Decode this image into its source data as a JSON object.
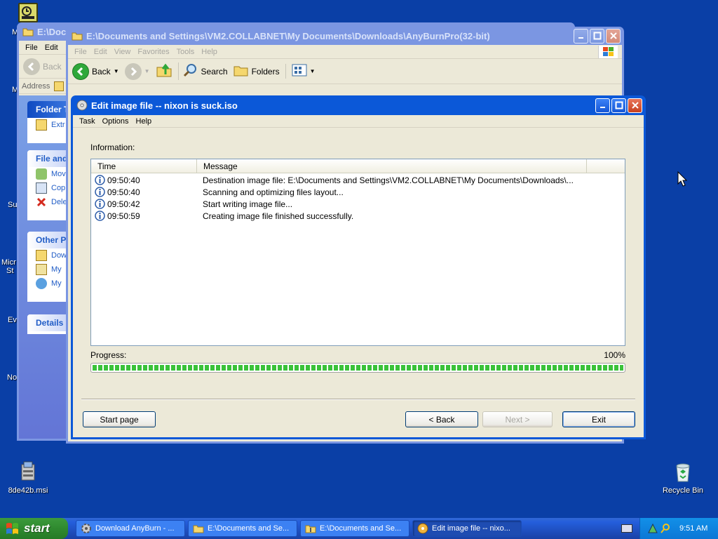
{
  "desktop": {
    "icons": [
      {
        "label": "8de42b.msi"
      },
      {
        "label": "Recycle Bin"
      }
    ],
    "edge_labels": [
      "M",
      "M",
      "Su",
      "Micr",
      "St",
      "Ev",
      "No"
    ]
  },
  "explorer_back": {
    "title": "E:\\Docu",
    "menu": [
      "File",
      "Edit"
    ],
    "back_label": "Back",
    "address_label": "Address",
    "panes": [
      {
        "header": "Folder T",
        "items": [
          "Extr"
        ]
      },
      {
        "header": "File and",
        "items": [
          "Mov",
          "Cop",
          "Dele"
        ]
      },
      {
        "header": "Other P",
        "items": [
          "Dow",
          "My",
          "My"
        ]
      },
      {
        "header": "Details",
        "items": []
      }
    ]
  },
  "explorer_front": {
    "title": "E:\\Documents and Settings\\VM2.COLLABNET\\My Documents\\Downloads\\AnyBurnPro(32-bit)",
    "menu": [
      "File",
      "Edit",
      "View",
      "Favorites",
      "Tools",
      "Help"
    ],
    "toolbar": {
      "back": "Back",
      "search": "Search",
      "folders": "Folders"
    }
  },
  "dialog": {
    "title": "Edit image file -- nixon is suck.iso",
    "menu": [
      "Task",
      "Options",
      "Help"
    ],
    "info_label": "Information:",
    "columns": [
      "Time",
      "Message"
    ],
    "rows": [
      {
        "time": "09:50:40",
        "message": "Destination image file:  E:\\Documents and Settings\\VM2.COLLABNET\\My Documents\\Downloads\\..."
      },
      {
        "time": "09:50:40",
        "message": "Scanning and optimizing files layout..."
      },
      {
        "time": "09:50:42",
        "message": "Start writing image file..."
      },
      {
        "time": "09:50:59",
        "message": "Creating image file finished successfully."
      }
    ],
    "progress_label": "Progress:",
    "progress_text": "100%",
    "progress_value": 1.0,
    "buttons": {
      "start_page": "Start page",
      "back": "< Back",
      "next": "Next >",
      "exit": "Exit"
    }
  },
  "taskbar": {
    "start": "start",
    "tasks": [
      {
        "label": "Download AnyBurn - ..."
      },
      {
        "label": "E:\\Documents and Se..."
      },
      {
        "label": "E:\\Documents and Se..."
      },
      {
        "label": "Edit image file -- nixo..."
      }
    ],
    "clock": "9:51 AM"
  },
  "colors": {
    "titlebar_active": "#0b58d8",
    "progress_fill": "#3ac23a",
    "desktop": "#0a3fa6"
  }
}
